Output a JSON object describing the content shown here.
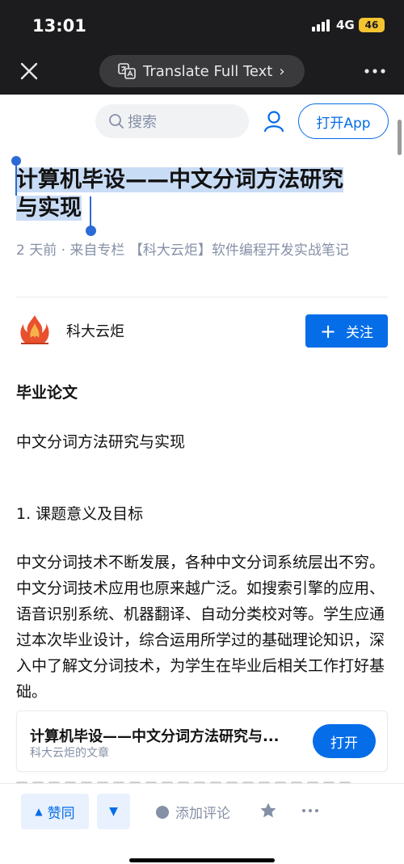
{
  "status_bar": {
    "time": "13:01",
    "network": "4G",
    "battery": "46"
  },
  "browser_bar": {
    "translate_label": "Translate Full Text",
    "translate_arrow": "›"
  },
  "header": {
    "search_placeholder": "搜索",
    "open_app_label": "打开App"
  },
  "article": {
    "title_line1": "计算机毕设——中文分词方法研究",
    "title_line2": "与实现",
    "meta": "2 天前 · 来自专栏 【科大云炬】软件编程开发实战笔记",
    "author": {
      "name": "科大云炬",
      "follow_label": "关注",
      "follow_icon": "+"
    },
    "body": {
      "heading": "毕业论文",
      "subtitle": "中文分词方法研究与实现",
      "section1": "1.  课题意义及目标",
      "para1": "中文分词技术不断发展，各种中文分词系统层出不穷。中文分词技术应用也原来越广泛。如搜索引擎的应用、语音识别系统、机器翻译、自动分类校对等。学生应通过本次毕业设计，综合运用所学过的基础理论知识，深入中了解文分词技术，为学生在毕业后相关工作打好基础。"
    },
    "card": {
      "title": "计算机毕设——中文分词方法研究与...",
      "subtitle": "科大云炬的文章",
      "open_label": "打开"
    }
  },
  "toolbar": {
    "upvote_label": "赞同",
    "upvote_icon": "▲",
    "downvote_icon": "▼",
    "comment_label": "添加评论"
  },
  "colors": {
    "accent": "#056de8",
    "selection": "#c9dcf5",
    "topbar": "#1c1c1e"
  }
}
